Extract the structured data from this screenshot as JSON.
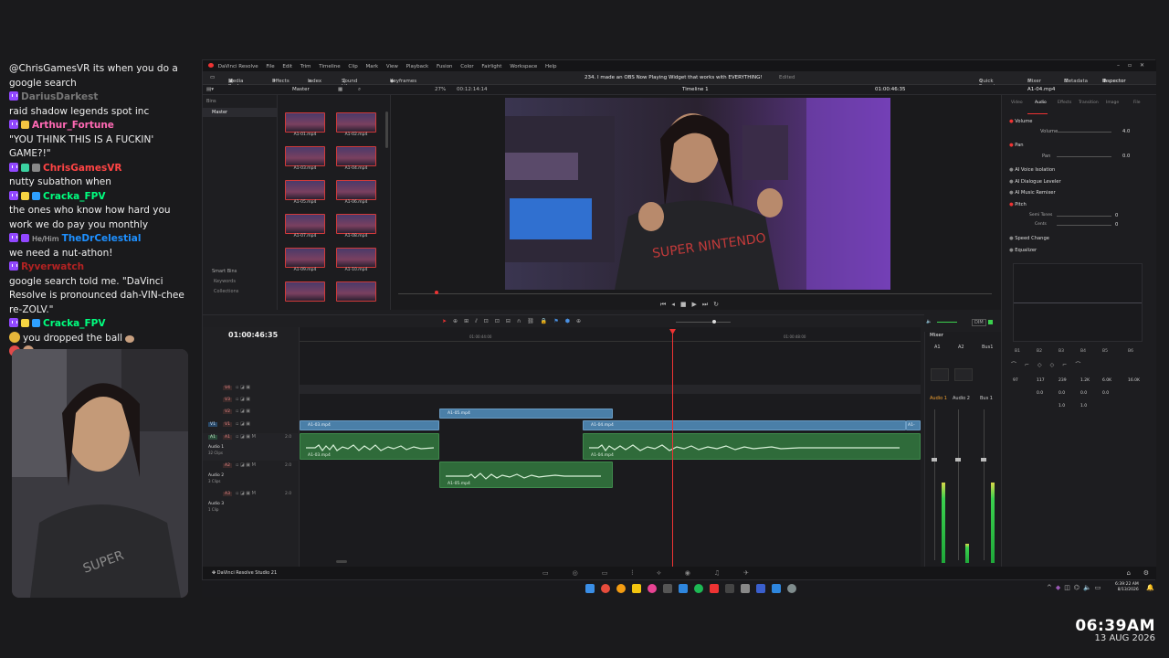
{
  "chat": [
    {
      "user": "",
      "text": "@ChrisGamesVR its when you do a google search",
      "color": ""
    },
    {
      "user": "DariusDarkest",
      "pron": "",
      "text": "raid shadow legends spot inc",
      "color": "#777777"
    },
    {
      "user": "Arthur_Fortune",
      "pron": "",
      "text": "\"YOU THINK THIS IS A FUCKIN' GAME?!\"",
      "color": "#ff69b4"
    },
    {
      "user": "ChrisGamesVR",
      "pron": "",
      "text": "nutty subathon when",
      "color": "#ff4444"
    },
    {
      "user": "Cracka_FPV",
      "pron": "",
      "text": "the ones who know how hard you work we do pay you monthly",
      "color": "#00ff7f"
    },
    {
      "user": "TheDrCelestial",
      "pron": "He/Him",
      "text": "we need a nut-athon!",
      "color": "#1e90ff"
    },
    {
      "user": "Ryverwatch",
      "pron": "",
      "text": "google search told me. \"DaVinci Resolve is pronounced dah-VIN-chee re-ZOLV.\"",
      "color": "#b22222"
    },
    {
      "user": "Cracka_FPV",
      "pron": "",
      "text": "you dropped the ball",
      "color": "#00ff7f"
    }
  ],
  "resolve": {
    "menu": [
      "DaVinci Resolve",
      "File",
      "Edit",
      "Trim",
      "Timeline",
      "Clip",
      "Mark",
      "View",
      "Playback",
      "Fusion",
      "Color",
      "Fairlight",
      "Workspace",
      "Help"
    ],
    "toolbar": {
      "media_pool": "Media Pool",
      "effects": "Effects",
      "index": "Index",
      "sound_library": "Sound Library",
      "keyframes": "Keyframes",
      "project_title": "234. I made an OBS Now Playing Widget that works with EVERYTHING!",
      "edited": "Edited",
      "quick_export": "Quick Export",
      "mixer": "Mixer",
      "metadata": "Metadata",
      "inspector": "Inspector"
    },
    "subbar": {
      "bin_label": "Master",
      "zoom": "27%",
      "source_tc": "00:12:14:14",
      "timeline_name": "Timeline 1",
      "timeline_tc": "01:00:46:35",
      "clip_name": "A1-04.mp4"
    },
    "bins": {
      "header": "Bins",
      "master": "Master",
      "smart_bins": "Smart Bins",
      "keywords": "Keywords",
      "collections": "Collections"
    },
    "clips": [
      "A1-01.mp4",
      "A1-02.mp4",
      "A1-03.mp4",
      "A1-04.mp4",
      "A1-05.mp4",
      "A1-06.mp4",
      "A1-07.mp4",
      "A1-08.mp4",
      "A1-09.mp4",
      "A1-10.mp4"
    ],
    "inspector": {
      "tabs": [
        "Video",
        "Audio",
        "Effects",
        "Transition",
        "Image",
        "File"
      ],
      "volume_label": "Volume",
      "volume_sub": "Volume",
      "volume_value": "4.0",
      "pan_label": "Pan",
      "pan_sub": "Pan",
      "pan_value": "0.0",
      "voice_isolation": "AI Voice Isolation",
      "dialogue_leveler": "AI Dialogue Leveler",
      "music_remixer": "AI Music Remixer",
      "pitch": "Pitch",
      "semi_tones": "Semi Tones",
      "semi_value": "0",
      "cents": "Cents",
      "cents_value": "0",
      "speed_change": "Speed Change",
      "equalizer": "Equalizer",
      "eq_bands": [
        "B1",
        "B2",
        "B3",
        "B4",
        "B5",
        "B6"
      ],
      "eq_freqs": [
        "97",
        "117",
        "239",
        "1.2K",
        "6.0K",
        "16.0K"
      ],
      "eq_gains": [
        "0.0",
        "0.0",
        "0.0",
        "0.0"
      ],
      "eq_q": [
        "1.0",
        "1.0"
      ]
    },
    "timeline": {
      "timecode": "01:00:46:35",
      "ruler": [
        "01:00:44:00",
        "01:00:48:00"
      ],
      "tracks": [
        {
          "id": "V4",
          "name": ""
        },
        {
          "id": "V3",
          "name": ""
        },
        {
          "id": "V2",
          "name": ""
        },
        {
          "id": "V1",
          "name": ""
        },
        {
          "id": "A1",
          "name": "Audio 1",
          "clips": "32 Clips",
          "level": "2.0"
        },
        {
          "id": "A2",
          "name": "Audio 2",
          "clips": "3 Clips",
          "level": "2.0"
        },
        {
          "id": "A3",
          "name": "Audio 3",
          "clips": "1 Clip",
          "level": "2.0"
        }
      ],
      "clip_labels": {
        "v2": "A1-05.mp4",
        "v1a": "A1-03.mp4",
        "v1b": "A1-04.mp4",
        "v1c": "A1-",
        "a1a": "A1-03.mp4",
        "a1b": "A1-04.mp4",
        "a2": "A1-05.mp4"
      }
    },
    "mixer": {
      "title": "Mixer",
      "channels": [
        "A1",
        "A2",
        "Bus1"
      ],
      "labels": [
        "Audio 1",
        "Audio 2",
        "Bus 1"
      ],
      "dim": "DIM"
    },
    "pages_label": "DaVinci Resolve Studio 21"
  },
  "taskbar": {
    "time": "6:39:22 AM",
    "date": "8/13/2026"
  },
  "overlay_clock": {
    "time": "06:39AM",
    "date": "13 AUG 2026"
  },
  "colors": {
    "accent": "#e33333",
    "video_clip": "#4a7fa8",
    "audio_clip": "#2f6b3a"
  }
}
